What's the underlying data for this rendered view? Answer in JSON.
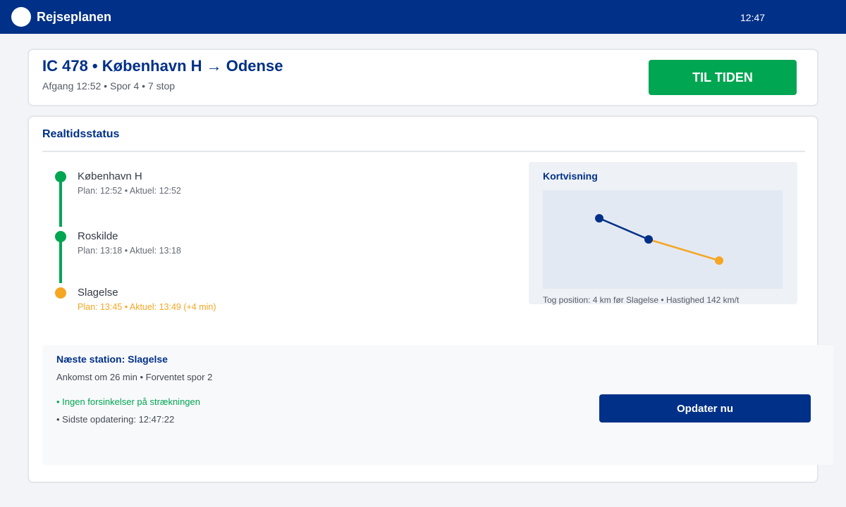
{
  "topbar": {
    "app_name": "Rejseplanen",
    "clock": "12:47"
  },
  "header": {
    "title": "IC 478 • København H → Odense",
    "subtitle": "Afgang 12:52 • Spor 4 • 7 stop",
    "status": "TIL TIDEN"
  },
  "realtime": {
    "section_title": "Realtidsstatus",
    "stops": [
      {
        "name": "København H",
        "times": "Plan: 12:52 • Aktuel: 12:52",
        "state": "passed",
        "color": "#00a651"
      },
      {
        "name": "Roskilde",
        "times": "Plan: 13:18 • Aktuel: 13:18",
        "state": "passed",
        "color": "#00a651"
      },
      {
        "name": "Slagelse",
        "times": "Plan: 13:45 • Aktuel: 13:49 (+4 min)",
        "state": "delayed",
        "color": "#f5a623"
      }
    ]
  },
  "map": {
    "title": "Kortvisning",
    "caption": "Tog position: 4 km før Slagelse • Hastighed 142 km/t"
  },
  "next_station": {
    "title": "Næste station: Slagelse",
    "subtitle": "Ankomst om 26 min • Forventet spor 2",
    "bullet_ok": "• Ingen forsinkelser på strækningen",
    "bullet_update": "• Sidste opdatering: 12:47:22",
    "refresh_label": "Opdater nu"
  },
  "colors": {
    "brand": "#003087",
    "on_time": "#00a651",
    "delay": "#f5a623"
  }
}
